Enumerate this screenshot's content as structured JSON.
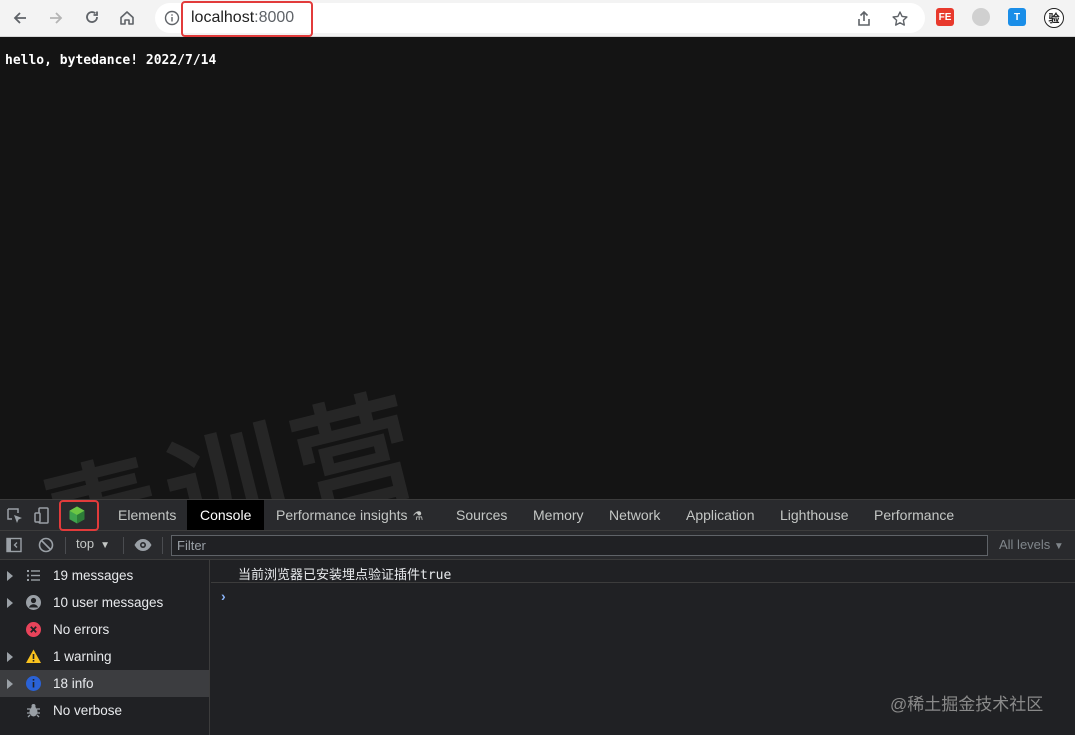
{
  "browser": {
    "url_host": "localhost",
    "url_port": ":8000",
    "extensions": [
      {
        "name": "fe-helper",
        "label": "FE",
        "color": "#e8392c"
      },
      {
        "name": "grey-extension",
        "label": "",
        "color": "#c8c8c8"
      },
      {
        "name": "translate-extension",
        "label": "T",
        "color": "#1a8ee8"
      },
      {
        "name": "verify-extension",
        "label": "验",
        "color": "#222222"
      }
    ]
  },
  "page": {
    "text": "hello, bytedance! 2022/7/14",
    "watermark": "青训营"
  },
  "devtools": {
    "tabs": [
      {
        "label": "Elements"
      },
      {
        "label": "Console"
      },
      {
        "label": "Performance insights"
      },
      {
        "label": "Sources"
      },
      {
        "label": "Memory"
      },
      {
        "label": "Network"
      },
      {
        "label": "Application"
      },
      {
        "label": "Lighthouse"
      },
      {
        "label": "Performance"
      }
    ],
    "active_tab": "Console",
    "context": "top",
    "filter_placeholder": "Filter",
    "levels": "All levels",
    "sidebar": [
      {
        "label": "19 messages",
        "icon": "list-icon"
      },
      {
        "label": "10 user messages",
        "icon": "user-icon"
      },
      {
        "label": "No errors",
        "icon": "error-icon"
      },
      {
        "label": "1 warning",
        "icon": "warning-icon"
      },
      {
        "label": "18 info",
        "icon": "info-icon"
      },
      {
        "label": "No verbose",
        "icon": "bug-icon"
      }
    ],
    "console_messages": [
      {
        "text": "当前浏览器已安装埋点验证插件true"
      }
    ],
    "prompt": "›"
  },
  "credit": "@稀土掘金技术社区",
  "colors": {
    "highlight": "#e23b3b",
    "accent": "#8ab4f8"
  }
}
